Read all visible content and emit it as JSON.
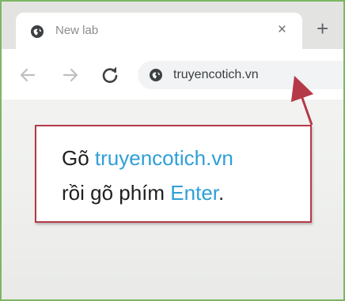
{
  "browser": {
    "tab": {
      "title": "New lab",
      "favicon": "globe-icon",
      "close_glyph": "×"
    },
    "new_tab_glyph": "+",
    "toolbar": {
      "back_icon": "arrow-left-icon",
      "forward_icon": "arrow-right-icon",
      "reload_icon": "reload-icon",
      "address": {
        "icon": "globe-icon",
        "value": "truyencotich.vn"
      }
    }
  },
  "annotation": {
    "line1_prefix": "Gõ ",
    "line1_highlight": "truyencotich.vn",
    "line2_prefix": "rồi gõ phím ",
    "line2_highlight": "Enter",
    "line2_suffix": ".",
    "colors": {
      "border": "#b53a48",
      "highlight": "#2f9fd6",
      "arrow": "#b53a48"
    }
  },
  "colors": {
    "frame_border": "#7cb663",
    "tabstrip": "#e3e4e1",
    "omnibox": "#f1f3f4"
  }
}
